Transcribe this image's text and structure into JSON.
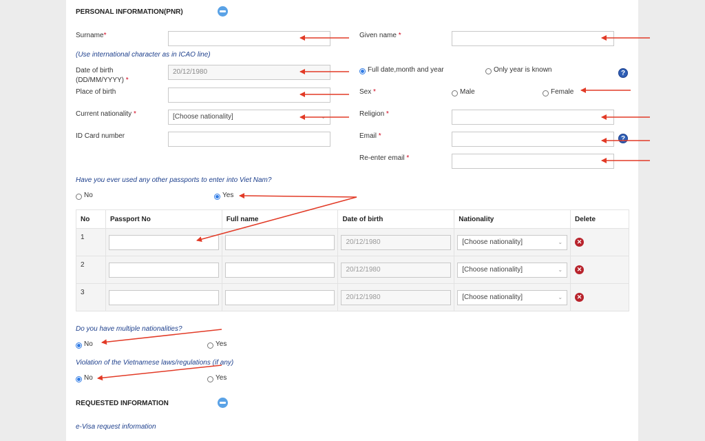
{
  "personal_section": {
    "title": "PERSONAL INFORMATION(PNR)",
    "surname_label": "Surname",
    "given_name_label": "Given name",
    "required_mark": "*",
    "intl_char_note": "(Use international character as in ICAO line)",
    "dob_label_line1": "Date of birth",
    "dob_label_line2": "(DD/MM/YYYY)",
    "dob_placeholder": "20/12/1980",
    "full_date_option": "Full date,month and year",
    "year_only_option": "Only year is known",
    "place_of_birth_label": "Place of birth",
    "sex_label": "Sex",
    "male_option": "Male",
    "female_option": "Female",
    "nationality_label": "Current nationality",
    "nationality_value": "[Choose nationality]",
    "religion_label": "Religion",
    "id_card_label": "ID Card number",
    "email_label": "Email",
    "reenter_email_label": "Re-enter email",
    "help_glyph": "?"
  },
  "other_passports": {
    "question": "Have you ever used any other passports to enter into Viet Nam?",
    "no_label": "No",
    "yes_label": "Yes",
    "selected": "Yes",
    "columns": [
      "No",
      "Passport No",
      "Full name",
      "Date of birth",
      "Nationality",
      "Delete"
    ],
    "rows": [
      {
        "no": "1",
        "dob_placeholder": "20/12/1980",
        "nationality": "[Choose nationality]"
      },
      {
        "no": "2",
        "dob_placeholder": "20/12/1980",
        "nationality": "[Choose nationality]"
      },
      {
        "no": "3",
        "dob_placeholder": "20/12/1980",
        "nationality": "[Choose nationality]"
      }
    ],
    "delete_glyph": "✕"
  },
  "multiple_nationalities": {
    "question": "Do you have multiple nationalities?",
    "no_label": "No",
    "yes_label": "Yes",
    "selected": "No"
  },
  "violation": {
    "question": "Violation of the Vietnamese laws/regulations (if any)",
    "no_label": "No",
    "yes_label": "Yes",
    "selected": "No"
  },
  "requested_section": {
    "title": "REQUESTED INFORMATION",
    "subtitle": "e-Visa request information"
  },
  "colors": {
    "accent_blue": "#2f7be5",
    "note_blue": "#1d3f8c",
    "required_red": "#d0021b",
    "arrow_red": "#e23a26",
    "delete_red": "#b8232c"
  }
}
